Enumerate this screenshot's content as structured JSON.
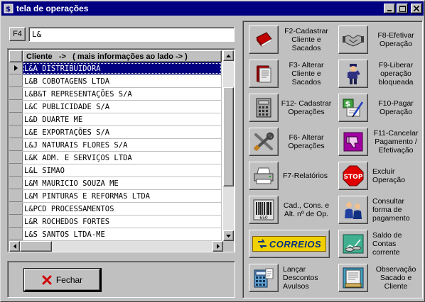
{
  "window": {
    "title": "tela de operações"
  },
  "search": {
    "shortcut_label": "F4",
    "value": "L&"
  },
  "grid": {
    "header": "Cliente   ->   ( mais informações ao lado -> )",
    "rows": [
      "L&A DISTRIBUIDORA",
      "L&B COBOTAGENS LTDA",
      "L&B&T REPRESENTAÇÕES S/A",
      "L&C PUBLICIDADE S/A",
      "L&D DUARTE ME",
      "L&E EXPORTAÇÕES S/A",
      "L&J NATURAIS FLORES S/A",
      "L&K ADM. E SERVIÇOS LTDA",
      "L&L SIMAO",
      "L&M MAURICIO SOUZA ME",
      "L&M PINTURAS E REFORMAS LTDA",
      "L&PCD PROCESSAMENTOS",
      "L&R ROCHEDOS FORTES",
      "L&S SANTOS LTDA-ME"
    ],
    "selected_index": 0
  },
  "close_button": {
    "label": "Fechar"
  },
  "actions": {
    "f2": {
      "label": "F2-Cadastrar Cliente e Sacados",
      "icon": "red-book-icon"
    },
    "f8": {
      "label": "F8-Efetivar Operação",
      "icon": "handshake-icon"
    },
    "f3": {
      "label": "F3- Alterar Cliente e Sacados",
      "icon": "open-book-icon"
    },
    "f9": {
      "label": "F9-Liberar operação bloqueada",
      "icon": "policeman-icon"
    },
    "f12": {
      "label": "F12- Cadastrar Operações",
      "icon": "calculator-icon"
    },
    "f10": {
      "label": "F10-Pagar Operação",
      "icon": "money-pen-icon"
    },
    "f6": {
      "label": "F6- Alterar Operações",
      "icon": "tools-icon"
    },
    "f11": {
      "label": "F11-Cancelar Pagamento / Efetivação",
      "icon": "thumbs-down-icon"
    },
    "f7": {
      "label": "F7-Relatórios",
      "icon": "printer-icon"
    },
    "excluir": {
      "label": "Excluir Operação",
      "icon": "stop-sign-icon"
    },
    "cad": {
      "label": "Cad., Cons. e Alt. nº de Op.",
      "icon": "barcode-icon"
    },
    "consultar": {
      "label": "Consultar forma de pagamento",
      "icon": "people-icon"
    },
    "correios": {
      "label": "CORREIOS",
      "icon": "correios-logo-icon"
    },
    "saldo": {
      "label": "Saldo de Contas corrente",
      "icon": "coins-icon"
    },
    "lancar": {
      "label": "Lançar Descontos Avulsos",
      "icon": "calculator-blue-icon"
    },
    "obs": {
      "label": "Observação Sacado e Cliente",
      "icon": "notebook-icon"
    }
  }
}
